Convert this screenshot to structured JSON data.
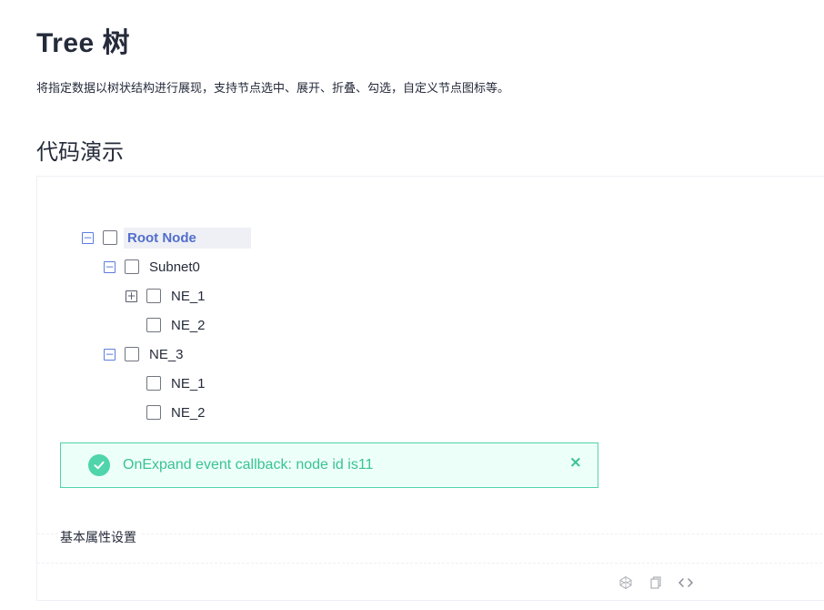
{
  "page": {
    "title": "Tree 树",
    "description": "将指定数据以树状结构进行展现，支持节点选中、展开、折叠、勾选，自定义节点图标等。",
    "section_title": "代码演示"
  },
  "tree": {
    "nodes": [
      {
        "label": "Root Node",
        "toggle": "−",
        "selected": true
      },
      {
        "label": "Subnet0",
        "toggle": "−"
      },
      {
        "label": "NE_1",
        "toggle": "+"
      },
      {
        "label": "NE_2",
        "toggle": ""
      },
      {
        "label": "NE_3",
        "toggle": "−"
      },
      {
        "label": "NE_1",
        "toggle": ""
      },
      {
        "label": "NE_2",
        "toggle": ""
      }
    ]
  },
  "alert": {
    "message": "OnExpand event callback: node id is11",
    "close_symbol": "×"
  },
  "props": {
    "title": "基本属性设置"
  },
  "toolbar": {
    "icons": [
      "codepen-icon",
      "copy-icon",
      "code-icon"
    ]
  },
  "colors": {
    "primary": "#5e7ce0",
    "success": "#50d4ab",
    "text": "#252b3a"
  }
}
